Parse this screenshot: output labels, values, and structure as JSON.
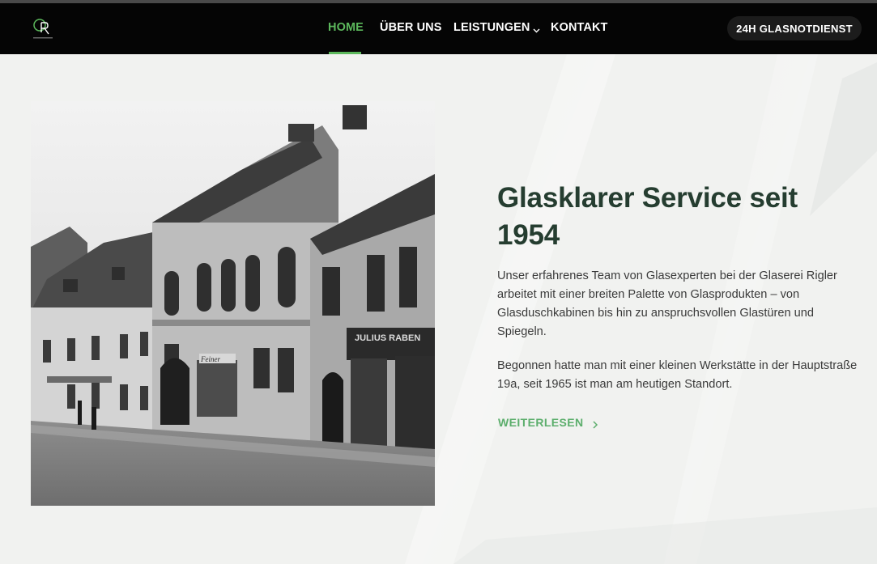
{
  "header": {
    "nav": [
      {
        "label": "HOME",
        "active": true
      },
      {
        "label": "ÜBER UNS",
        "active": false
      },
      {
        "label": "LEISTUNGEN",
        "active": false,
        "has_dropdown": true
      },
      {
        "label": "KONTAKT",
        "active": false
      }
    ],
    "cta_label": "24H GLASNOTDIENST"
  },
  "hero": {
    "heading": "Glasklarer Service seit 1954",
    "paragraphs": [
      "Unser erfahrenes Team von Glasexperten bei der Glaserei Rigler arbeitet mit einer breiten Palette von Glasprodukten – von Glasduschkabinen bis hin zu anspruchsvollen Glastüren und Spiegeln.",
      "Begonnen hatte man mit einer kleinen Werkstätte in der Hauptstraße 19a, seit 1965 ist man am heutigen Standort."
    ],
    "read_more_label": "WEITERLESEN",
    "photo_signs": [
      "JULIUS RABEN",
      "Feiner"
    ]
  },
  "colors": {
    "accent": "#5cb85c",
    "heading": "#253d30",
    "navbar": "#050505",
    "background": "#f1f2f0"
  },
  "icons": {
    "logo": "glaserei-rigler-logo-icon",
    "dropdown": "chevron-down-icon",
    "read_more": "chevron-right-icon"
  }
}
